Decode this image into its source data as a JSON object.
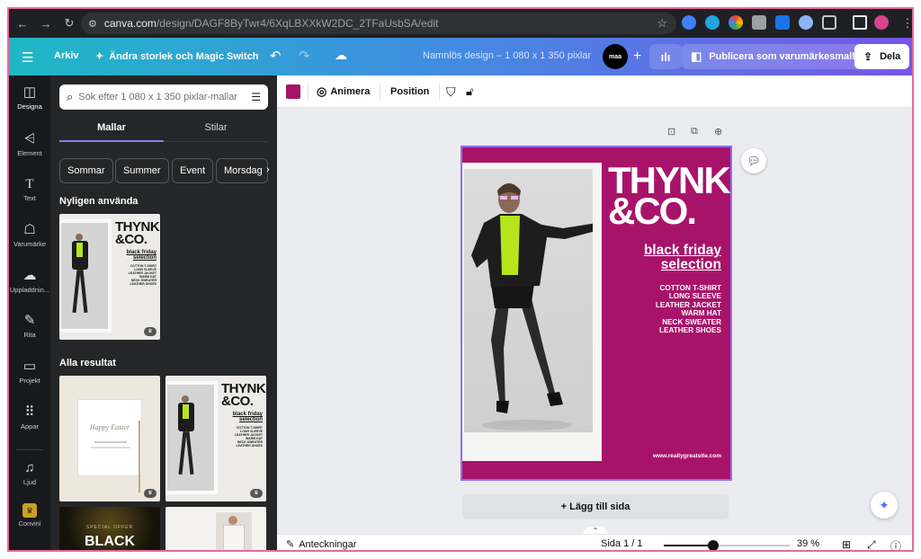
{
  "browser": {
    "url_host": "canva.com",
    "url_path": "/design/DAGF8ByTwr4/6XqLBXXkW2DC_2TFaUsbSA/edit"
  },
  "header": {
    "menu_label": "Arkiv",
    "resize_label": "Ändra storlek och Magic Switch",
    "doc_title": "Namnlös design – 1 080 x 1 350 pixlar",
    "avatar_label": "maa",
    "publish_label": "Publicera som varumärkesmall",
    "share_label": "Dela"
  },
  "rail": {
    "items": [
      {
        "label": "Designa",
        "icon": "design-icon"
      },
      {
        "label": "Element",
        "icon": "elements-icon"
      },
      {
        "label": "Text",
        "icon": "text-icon"
      },
      {
        "label": "Varumärke",
        "icon": "brand-icon"
      },
      {
        "label": "Uppladdnin...",
        "icon": "upload-icon"
      },
      {
        "label": "Rita",
        "icon": "draw-icon"
      },
      {
        "label": "Projekt",
        "icon": "folder-icon"
      },
      {
        "label": "Appar",
        "icon": "apps-icon"
      },
      {
        "label": "Ljud",
        "icon": "audio-icon"
      },
      {
        "label": "Convini",
        "icon": "convini-icon"
      }
    ]
  },
  "panel": {
    "search_placeholder": "Sök efter 1 080 x 1 350 pixlar-mallar",
    "tab_templates": "Mallar",
    "tab_styles": "Stilar",
    "chips": [
      "Sommar",
      "Summer",
      "Event",
      "Morsdag"
    ],
    "recent_title": "Nyligen använda",
    "all_title": "Alla resultat",
    "thumb_happy_text": "Happy Easter",
    "thumb_special_offer": "SPECIAL OFFER",
    "thumb_black": "BLACK"
  },
  "toolbar": {
    "color": "#a8136a",
    "animate_label": "Animera",
    "position_label": "Position"
  },
  "design": {
    "logo_line1": "THYNK",
    "logo_line2": "&CO.",
    "bf_line1": "black friday",
    "bf_line2": "selection",
    "items": [
      "COTTON T-SHIRT",
      "LONG SLEEVE",
      "LEATHER JACKET",
      "WARM HAT",
      "NECK SWEATER",
      "LEATHER SHOES"
    ],
    "site": "www.reallygreatsite.com",
    "background": "#a8136a"
  },
  "editor": {
    "add_page_label": "+ Lägg till sida"
  },
  "statusbar": {
    "notes_label": "Anteckningar",
    "page_label": "Sida 1 / 1",
    "zoom_label": "39 %",
    "zoom_value": 39
  }
}
